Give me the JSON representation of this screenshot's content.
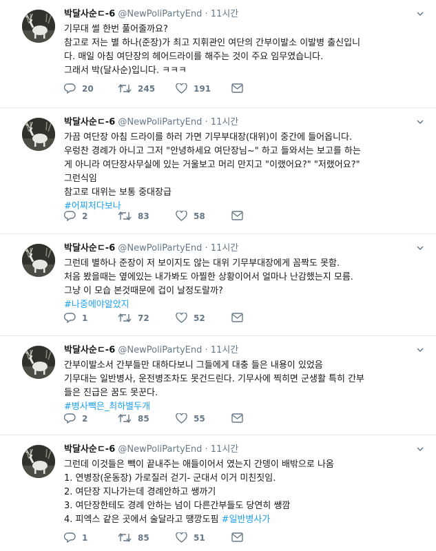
{
  "tweets": [
    {
      "name": "박달사순ㄷ-6",
      "handle": "@NewPoliPartyEnd",
      "dot": "·",
      "time": "11시간",
      "lines": [
        "기무대 썰 한번 풀어줄까요?",
        "참고로 저는 별 하나(준장)가 최고 지휘관인 여단의 간부이발소 이발병 출신입니",
        "다. 매일 아침 여단장의 헤어드라이를 해주는 것이 주요 임무였습니다.",
        "그래서 박(달사순)입니다. ㅋㅋㅋ"
      ],
      "hashtag": "",
      "replies": "20",
      "retweets": "245",
      "likes": "191"
    },
    {
      "name": "박달사순ㄷ-6",
      "handle": "@NewPoliPartyEnd",
      "dot": "·",
      "time": "11시간",
      "lines": [
        "가끔 여단장 아침 드라이를 하러 가면 기무부대장(대위)이 중간에 들어옵니다.",
        "우렁찬 경례가 아니고 그저 \"안녕하세요 여단장님~\" 하고 들와서는 보고를 하는",
        "게 아니라 여단장사무실에 있는 거울보고 머리 만지고 \"이랬어요?\" \"저랬어요?\"",
        "그런식임",
        "참고로 대위는 보통 중대장급"
      ],
      "hashtag": "#어찌처다보나",
      "replies": "2",
      "retweets": "83",
      "likes": "58"
    },
    {
      "name": "박달사순ㄷ-6",
      "handle": "@NewPoliPartyEnd",
      "dot": "·",
      "time": "11시간",
      "lines": [
        "그런데 별하나 준장이 저 보이지도 않는 대위 기무부대장에게 꼼짝도 못함.",
        "처음 봤을때는 옆에있는 내가봐도 아찔한 상황이어서 얼마나 난감했는지 모름.",
        "그냥 이 모습 본것때문에 겁이 날정도랄까?"
      ],
      "hashtag": "#나중에야알았지",
      "replies": "1",
      "retweets": "72",
      "likes": "52"
    },
    {
      "name": "박달사순ㄷ-6",
      "handle": "@NewPoliPartyEnd",
      "dot": "·",
      "time": "11시간",
      "lines": [
        "간부이발소서 간부들만 대하다보니 그들에게 대충 들은 내용이 있었음",
        "기무대는 일반병사, 운전병조차도 못건드린다. 기무사에 찍히면 군생활 특히 간부",
        "들은 진급은 꿈도 못꾼다."
      ],
      "hashtag": "#병사빽은_최하별두개",
      "replies": "2",
      "retweets": "85",
      "likes": "55"
    },
    {
      "name": "박달사순ㄷ-6",
      "handle": "@NewPoliPartyEnd",
      "dot": "·",
      "time": "11시간",
      "lines": [
        "그런데 이것들은 빽이 끝내주는 애들이어서 였는지 간뎅이 배밖으로 나옴",
        "1. 연병장(운동장) 가로질러 걷기- 군대서 이거 미친짓임.",
        "2. 여단장 지나가는데 경례안하고 쌩까기",
        "3. 여단장한테도 경례 안하는 넘이 다른간부들도 당연히 쌩깜",
        "4. 피엑스 같은 곳에서 술달라고 땡깡도핌 "
      ],
      "hashtag_inline": "#일반병사가",
      "hashtag": "",
      "replies": "1",
      "retweets": "85",
      "likes": "51"
    }
  ],
  "colors": {
    "text": "#14171a",
    "secondary": "#657786",
    "link": "#1da1f2",
    "divider": "#e6ecf0"
  },
  "icons": [
    "chevron-down-icon",
    "reply-icon",
    "retweet-icon",
    "like-icon",
    "dm-icon"
  ]
}
